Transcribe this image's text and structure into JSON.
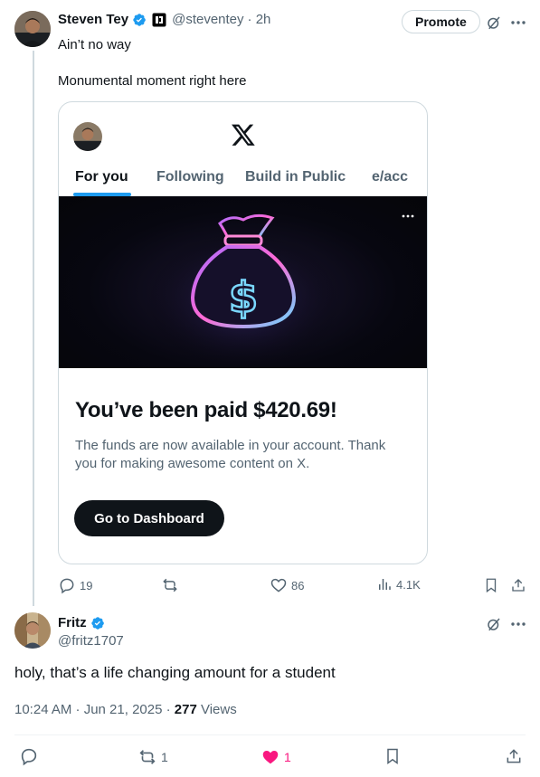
{
  "post": {
    "author_name": "Steven Tey",
    "handle": "@steventey",
    "time": "· 2h",
    "promote_label": "Promote",
    "text_line1": "Ain’t no way",
    "text_line2": "Monumental moment right here",
    "embed": {
      "logo": "X",
      "tabs": [
        "For you",
        "Following",
        "Build in Public",
        "e/acc"
      ],
      "active_tab": "For you",
      "paid_title": "You’ve been paid $420.69!",
      "paid_body": "The funds are now available in your account. Thank you for making awesome content on X.",
      "button_label": "Go to Dashboard",
      "media_icon": "money-bag-icon"
    },
    "stats": {
      "replies": "19",
      "reposts": "",
      "likes": "86",
      "views": "4.1K"
    }
  },
  "reply": {
    "author_name": "Fritz",
    "handle": "@fritz1707",
    "text": "holy, that’s a life changing amount for a student",
    "timestamp": "10:24 AM · Jun 21, 2025 · ",
    "views_count": "277",
    "views_label": " Views",
    "stats": {
      "reposts": "1",
      "likes": "1"
    }
  },
  "colors": {
    "verified": "#1d9bf0",
    "like_active": "#f91880",
    "muted": "#536471",
    "accent": "#1d9bf0"
  }
}
